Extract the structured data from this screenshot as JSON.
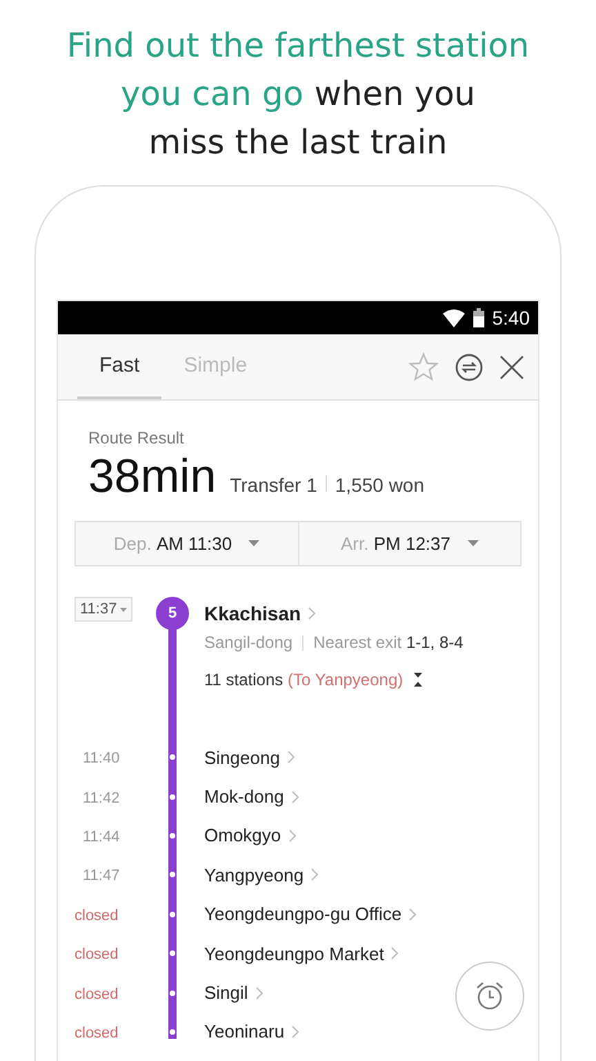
{
  "headline": {
    "lines": [
      [
        {
          "text": "Find out the farthest station",
          "accent": true
        }
      ],
      [
        {
          "text": "you can go",
          "accent": true
        },
        {
          "text": "when you",
          "accent": false
        }
      ],
      [
        {
          "text": "miss the last train",
          "accent": false
        }
      ]
    ]
  },
  "status_bar": {
    "time": "5:40"
  },
  "tabs": [
    {
      "label": "Fast",
      "selected": true
    },
    {
      "label": "Simple",
      "selected": false
    }
  ],
  "route": {
    "label": "Route Result",
    "duration": "38min",
    "transfer": "Transfer 1",
    "fare": "1,550 won"
  },
  "times": [
    {
      "label": "Dep.",
      "value": "AM 11:30"
    },
    {
      "label": "Arr.",
      "value": "PM 12:37"
    }
  ],
  "line": {
    "number": "5",
    "color": "#8a3fd0"
  },
  "boarding": {
    "time": "11:37",
    "station": "Kkachisan",
    "area": "Sangil-dong",
    "exit_label": "Nearest exit",
    "exits": "1-1, 8-4",
    "count": "11 stations",
    "direction": "(To Yanpyeong)"
  },
  "stops": [
    {
      "time": "11:40",
      "name": "Singeong",
      "closed": false
    },
    {
      "time": "11:42",
      "name": "Mok-dong",
      "closed": false
    },
    {
      "time": "11:44",
      "name": "Omokgyo",
      "closed": false
    },
    {
      "time": "11:47",
      "name": "Yangpyeong",
      "closed": false
    },
    {
      "time": "closed",
      "name": "Yeongdeungpo-gu Office",
      "closed": true
    },
    {
      "time": "closed",
      "name": "Yeongdeungpo Market",
      "closed": true
    },
    {
      "time": "closed",
      "name": "Singil",
      "closed": true
    },
    {
      "time": "closed",
      "name": "Yeoninaru",
      "closed": true
    }
  ]
}
